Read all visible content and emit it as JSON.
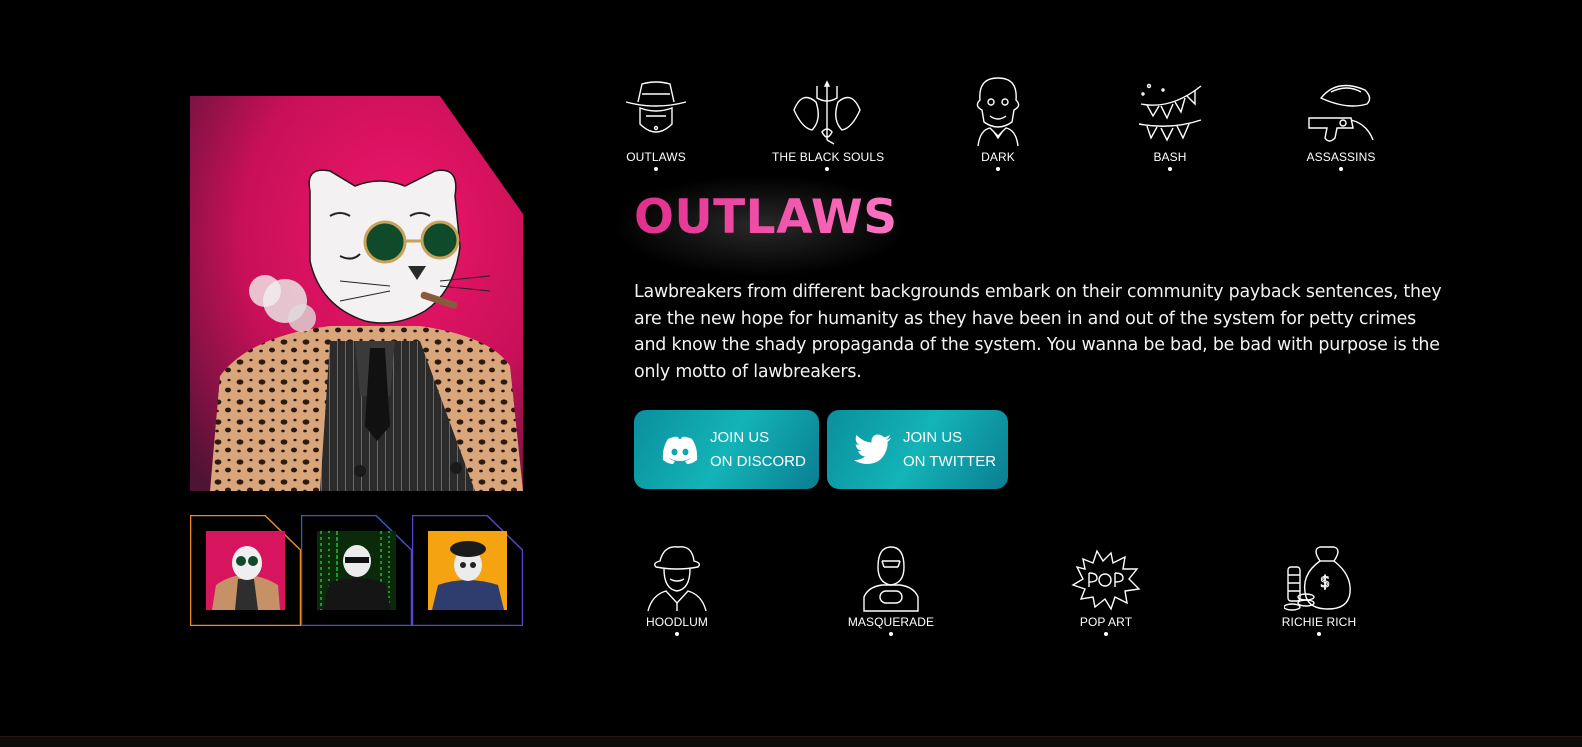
{
  "categories_top": [
    {
      "label": "OUTLAWS",
      "icon": "cowboy-bandit-icon"
    },
    {
      "label": "THE BLACK SOULS",
      "icon": "demon-trident-icon"
    },
    {
      "label": "DARK",
      "icon": "clown-icon"
    },
    {
      "label": "BASH",
      "icon": "party-bunting-icon"
    },
    {
      "label": "ASSASSINS",
      "icon": "hat-revolver-icon"
    }
  ],
  "categories_bottom": [
    {
      "label": "HOODLUM",
      "icon": "hooded-figure-icon"
    },
    {
      "label": "MASQUERADE",
      "icon": "masked-figure-icon"
    },
    {
      "label": "POP ART",
      "icon": "pop-burst-icon"
    },
    {
      "label": "RICHIE RICH",
      "icon": "money-bag-icon"
    }
  ],
  "feature": {
    "title": "OUTLAWS",
    "description": "Lawbreakers from different backgrounds embark on their community payback sentences, they are the new hope for humanity as they have been in and out of the system for petty crimes and know the shady propaganda of the system. You wanna be bad, be bad with purpose is the only motto of lawbreakers."
  },
  "buttons": {
    "discord": {
      "line1": "JOIN US",
      "line2": "ON DISCORD",
      "icon": "discord-icon"
    },
    "twitter": {
      "line1": "JOIN US",
      "line2": "ON TWITTER",
      "icon": "twitter-icon"
    }
  },
  "thumbnails": [
    {
      "name": "tiger-pink",
      "selected": true,
      "frame_color": "#f08a1c"
    },
    {
      "name": "tiger-matrix",
      "selected": false,
      "frame_color": "#5a43c9"
    },
    {
      "name": "tiger-beret",
      "selected": false,
      "frame_color": "#5a43c9"
    }
  ],
  "colors": {
    "background": "#000000",
    "title_pink": "#ee3f98",
    "button_teal": "#13b4b8",
    "hero_bg": "#d6155e"
  }
}
